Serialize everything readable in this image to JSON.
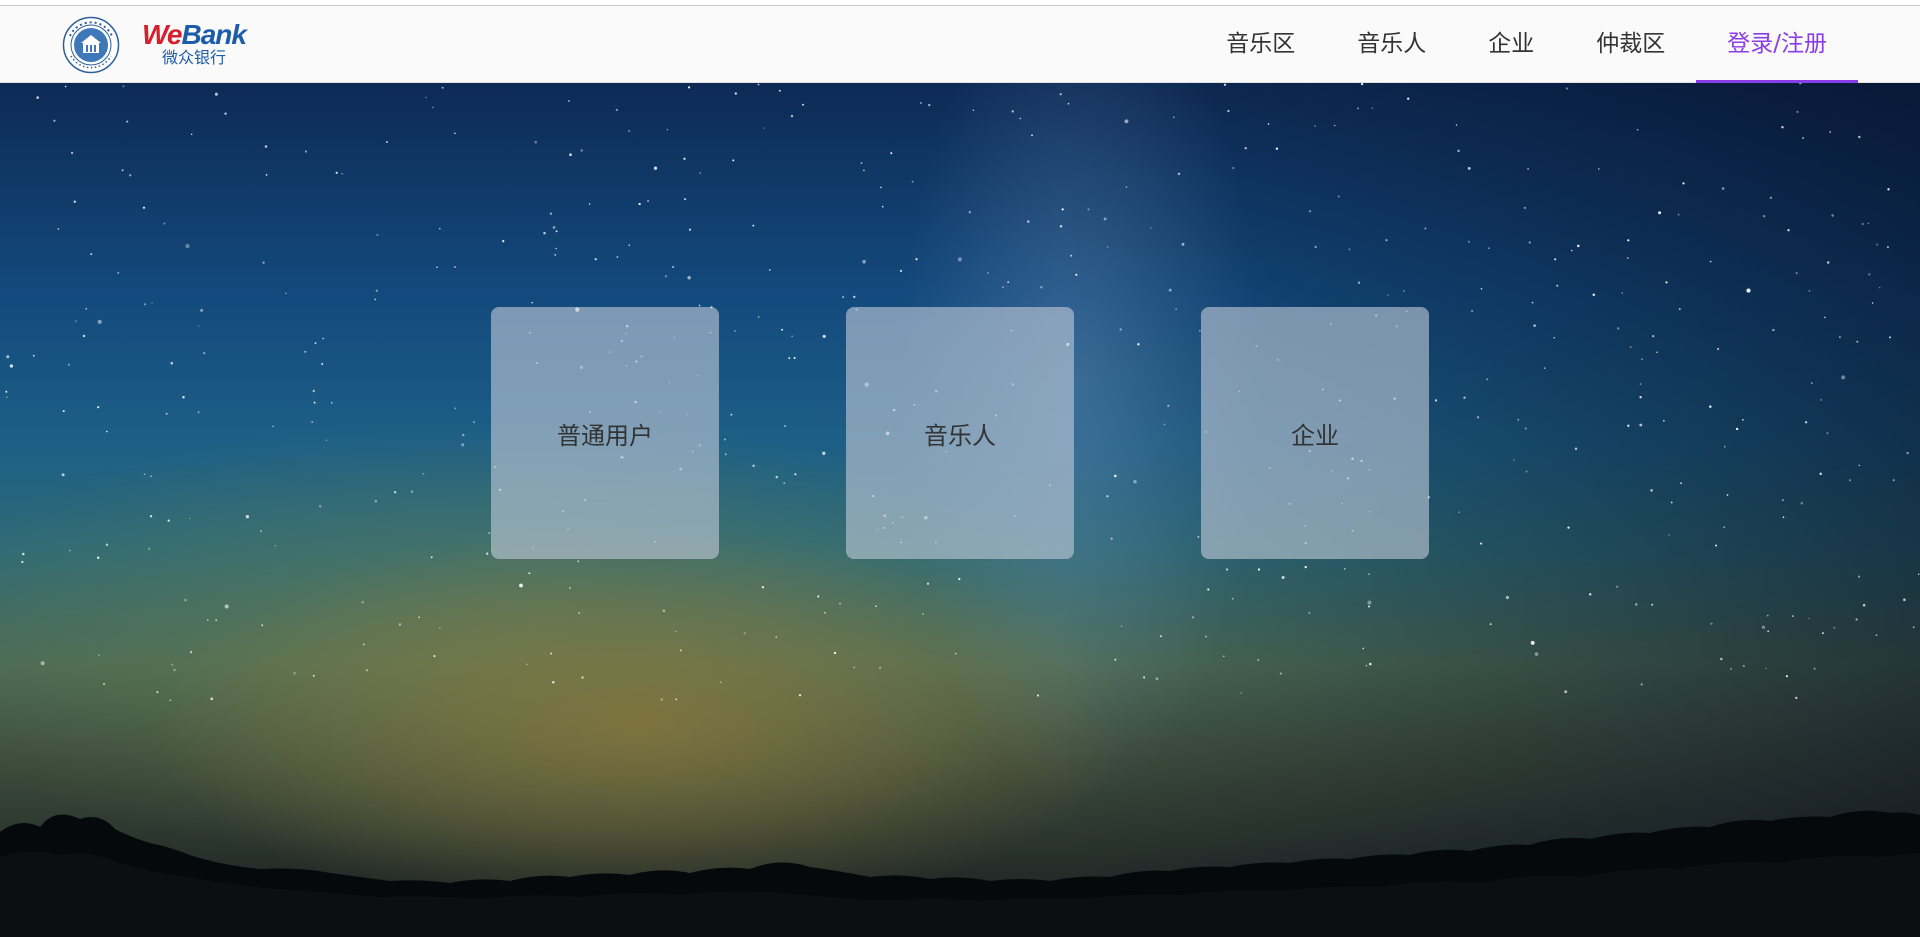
{
  "header": {
    "logo_seal_icon": "university-seal-icon",
    "logo_brand": {
      "we": "We",
      "bank": "Bank",
      "chinese": "微众银行"
    },
    "nav": [
      {
        "label": "音乐区",
        "active": false
      },
      {
        "label": "音乐人",
        "active": false
      },
      {
        "label": "企业",
        "active": false
      },
      {
        "label": "仲裁区",
        "active": false
      },
      {
        "label": "登录/注册",
        "active": true
      }
    ],
    "active_color": "#8a3ee8"
  },
  "hero": {
    "background": "starry-night-sky-image",
    "cards": [
      {
        "label": "普通用户"
      },
      {
        "label": "音乐人"
      },
      {
        "label": "企业"
      }
    ]
  },
  "colors": {
    "we_red": "#d6202d",
    "bank_blue": "#1b5cab",
    "nav_text": "#333333"
  }
}
